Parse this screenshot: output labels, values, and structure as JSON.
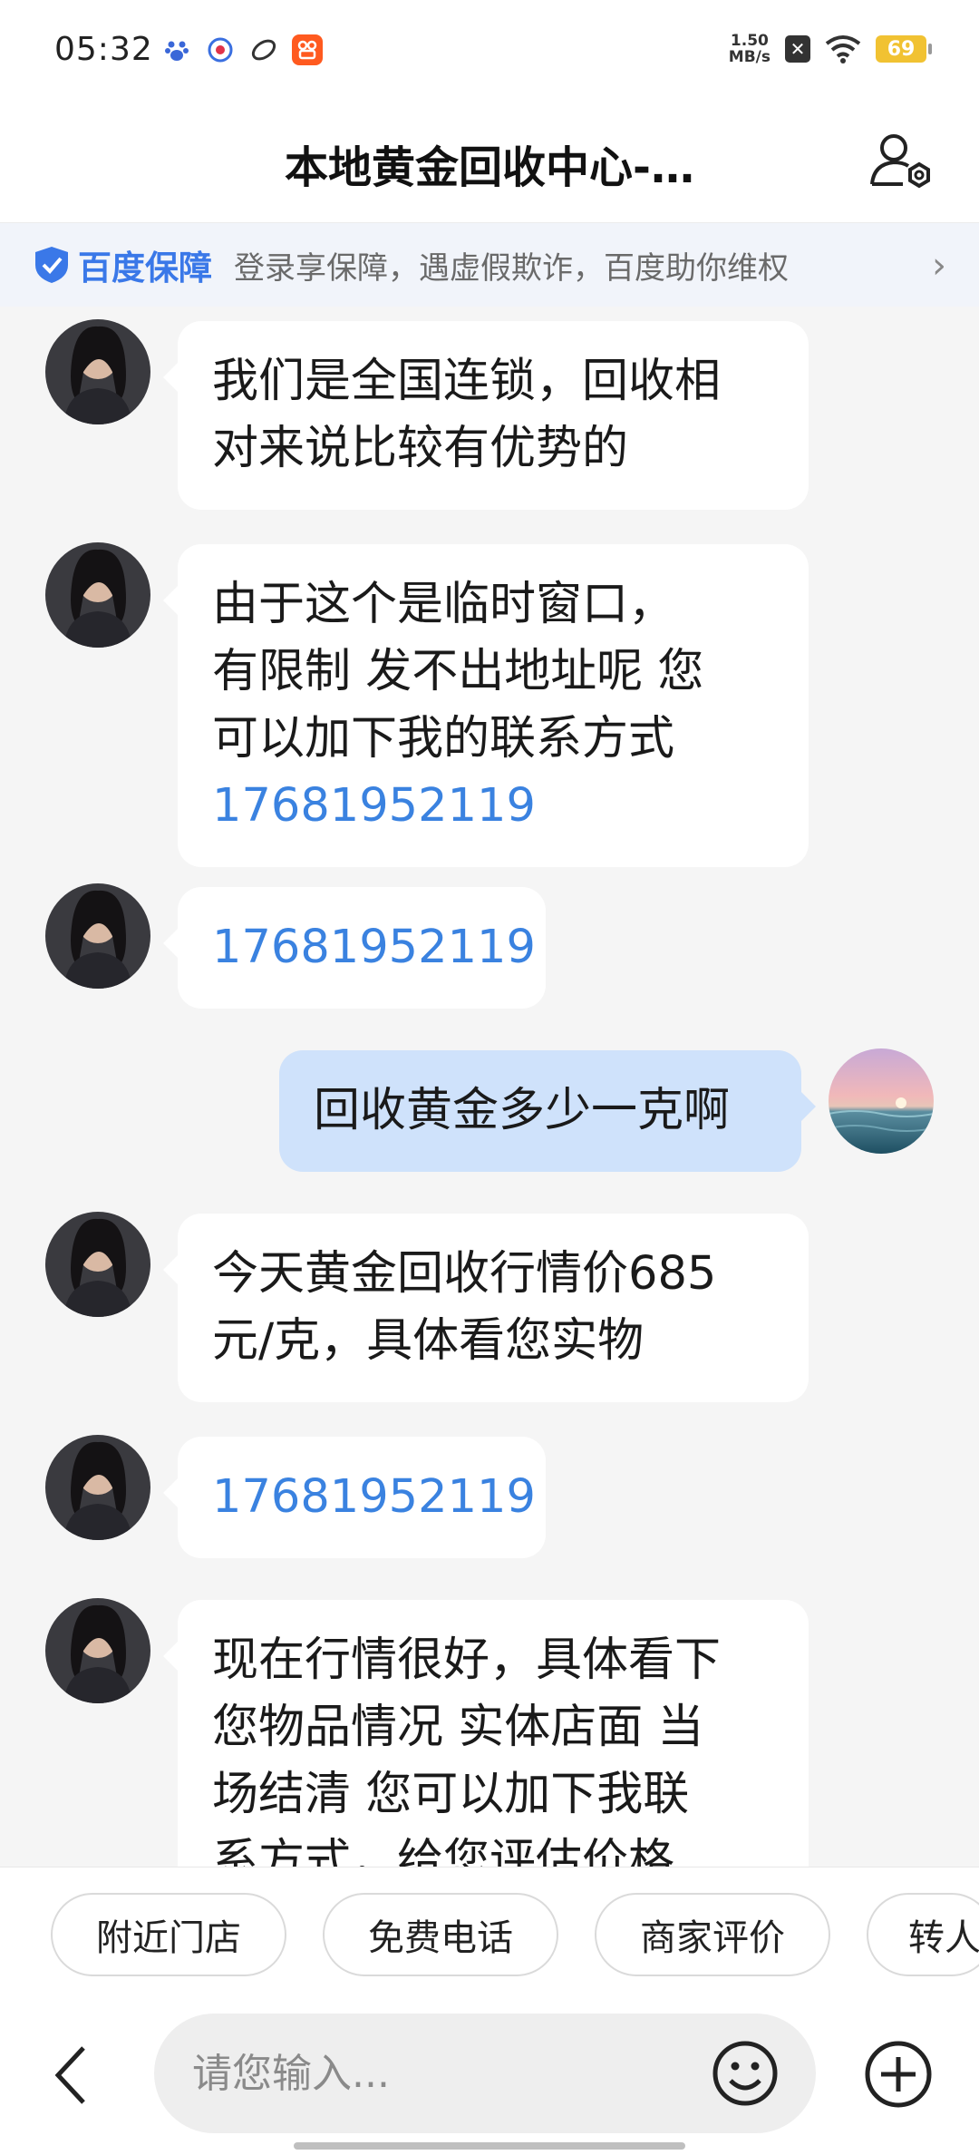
{
  "status_bar": {
    "time": "05:32",
    "speed_value": "1.50",
    "speed_unit": "MB/s",
    "battery": "69",
    "app_icons": [
      "baidu-paw-icon",
      "dot-app-icon",
      "leaf-app-icon",
      "kuaishou-icon"
    ]
  },
  "header": {
    "title": "本地黄金回收中心-…"
  },
  "notice": {
    "brand": "百度保障",
    "text": "登录享保障，遇虚假欺诈，百度助你维权",
    "arrow": "›"
  },
  "messages": [
    {
      "side": "left",
      "lines": [
        "我们是全国连锁，回收相",
        "对来说比较有优势的"
      ]
    },
    {
      "side": "left",
      "lines": [
        "由于这个是临时窗口，",
        "有限制 发不出地址呢  您",
        "可以加下我的联系方式"
      ],
      "phone": "17681952119"
    },
    {
      "side": "left",
      "phone": "17681952119"
    },
    {
      "side": "right",
      "lines": [
        "回收黄金多少一克啊"
      ]
    },
    {
      "side": "left",
      "lines": [
        "今天黄金回收行情价685",
        "元/克，具体看您实物"
      ]
    },
    {
      "side": "left",
      "phone": "17681952119"
    },
    {
      "side": "left",
      "lines": [
        "现在行情很好，具体看下",
        "您物品情况   实体店面 当",
        "场结清  您可以加下我联",
        "系方式，给您评估价格"
      ]
    }
  ],
  "quick_actions": [
    "附近门店",
    "免费电话",
    "商家评价",
    "转人"
  ],
  "input": {
    "placeholder": "请您输入..."
  },
  "colors": {
    "accent_blue": "#3a82e0",
    "self_bubble": "#cfe2fb",
    "battery": "#f1c232"
  }
}
